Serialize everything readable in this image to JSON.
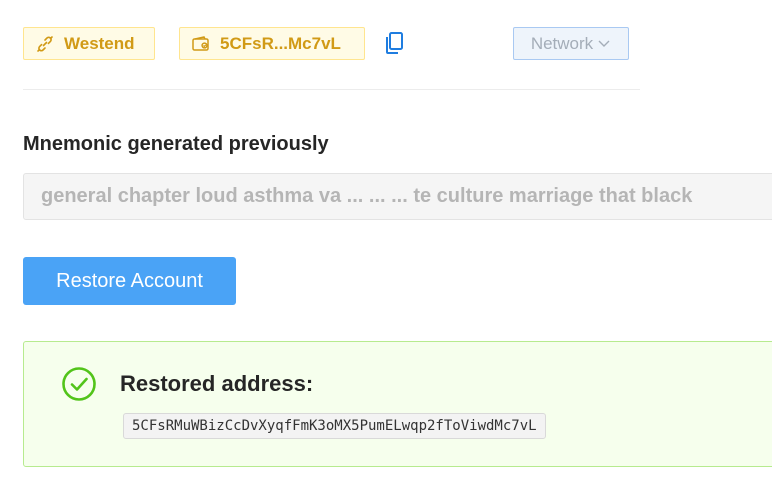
{
  "header": {
    "network_tag": {
      "label": "Westend",
      "icon": "link-icon"
    },
    "account_tag": {
      "label": "5CFsR...Mc7vL",
      "icon": "wallet-icon"
    },
    "copy_icon": "copy-icon",
    "network_select": {
      "label": "Network",
      "icon": "chevron-down-icon"
    }
  },
  "mnemonic": {
    "label": "Mnemonic generated previously",
    "value": "general chapter loud asthma va ... ... ... te culture marriage that black"
  },
  "restore_button": {
    "label": "Restore Account"
  },
  "result": {
    "title": "Restored address:",
    "address": "5CFsRMuWBizCcDvXyqfFmK3oMX5PumELwqp2fToViwdMc7vL",
    "icon": "check-circle-icon"
  },
  "colors": {
    "tag_text": "#d19a16",
    "tag_bg": "#fffbe6",
    "primary": "#4aa3f6",
    "success": "#52c41a",
    "success_bg": "#f6ffed"
  }
}
